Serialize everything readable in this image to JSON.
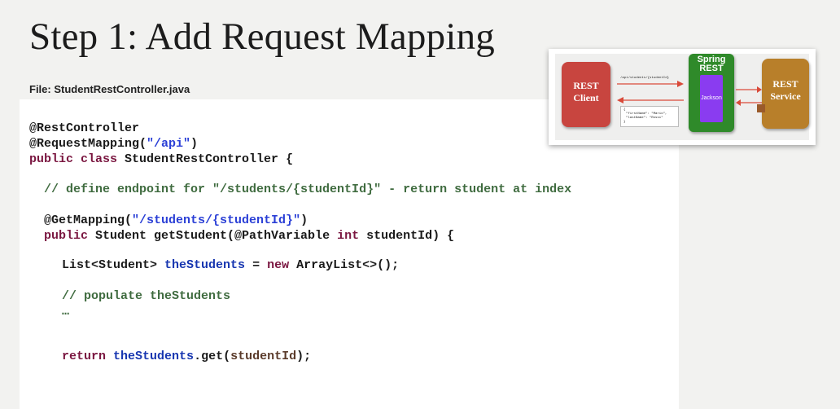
{
  "slide": {
    "title": "Step 1: Add Request Mapping",
    "file_label": "File: StudentRestController.java"
  },
  "code": {
    "annotation_rest_controller": "@RestController",
    "annotation_request_mapping": "@RequestMapping(",
    "request_mapping_path": "\"/api\"",
    "close_paren": ")",
    "kw_public_class": "public class",
    "class_decl_rest": " StudentRestController {",
    "comment_define": "// define endpoint for \"/students/{studentId}\" - return student at index",
    "annotation_get_mapping": "@GetMapping(",
    "get_mapping_path": "\"/students/{studentId}\"",
    "kw_public": "public",
    "method_sig_part1": " Student getStudent(@PathVariable ",
    "kw_int": "int",
    "method_sig_part2": " studentId) {",
    "list_type": "List<Student> ",
    "var_the_students": "theStudents",
    "assign_eq": " = ",
    "kw_new": "new",
    "new_arraylist": " ArrayList<>();",
    "comment_populate": "// populate theStudents",
    "ellipsis": "…",
    "kw_return": "return",
    "space": " ",
    "get_call": ".get(",
    "arg_student_id": "studentId",
    "end_stmt": ");"
  },
  "diagram": {
    "client_line1": "REST",
    "client_line2": "Client",
    "spring_line1": "Spring",
    "spring_line2": "REST",
    "jackson_label": "Jackson",
    "service_line1": "REST",
    "service_line2": "Service",
    "request_url": "/api/students/{studentId}",
    "json_line1": "{",
    "json_line2": "\"firstName\": \"Mario\",",
    "json_line3": "\"lastName\": \"Rossi\"",
    "json_line4": "}",
    "colors": {
      "client": "#c8453f",
      "spring": "#2f8a2a",
      "jackson": "#8a3cf0",
      "service": "#b87f2a",
      "arrow": "#d94a3a"
    }
  }
}
